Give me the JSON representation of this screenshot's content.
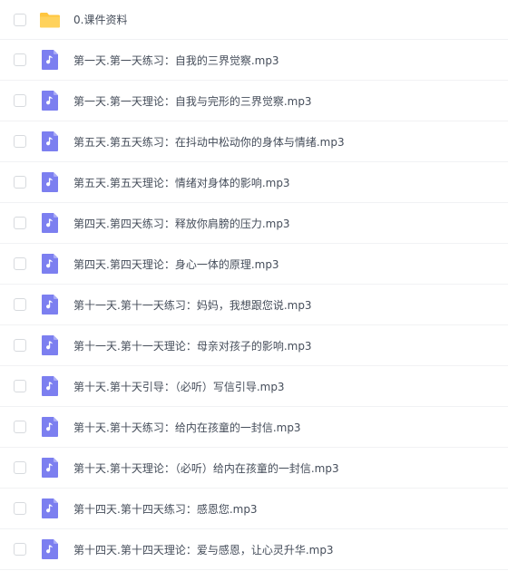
{
  "files": [
    {
      "name": "0.课件资料",
      "icon": "folder-icon",
      "type": "folder"
    },
    {
      "name": "第一天.第一天练习：自我的三界觉察.mp3",
      "icon": "audio-file-icon",
      "type": "audio"
    },
    {
      "name": "第一天.第一天理论：自我与完形的三界觉察.mp3",
      "icon": "audio-file-icon",
      "type": "audio"
    },
    {
      "name": "第五天.第五天练习：在抖动中松动你的身体与情绪.mp3",
      "icon": "audio-file-icon",
      "type": "audio"
    },
    {
      "name": "第五天.第五天理论：情绪对身体的影响.mp3",
      "icon": "audio-file-icon",
      "type": "audio"
    },
    {
      "name": "第四天.第四天练习：释放你肩膀的压力.mp3",
      "icon": "audio-file-icon",
      "type": "audio"
    },
    {
      "name": "第四天.第四天理论：身心一体的原理.mp3",
      "icon": "audio-file-icon",
      "type": "audio"
    },
    {
      "name": "第十一天.第十一天练习：妈妈，我想跟您说.mp3",
      "icon": "audio-file-icon",
      "type": "audio"
    },
    {
      "name": "第十一天.第十一天理论：母亲对孩子的影响.mp3",
      "icon": "audio-file-icon",
      "type": "audio"
    },
    {
      "name": "第十天.第十天引导：（必听）写信引导.mp3",
      "icon": "audio-file-icon",
      "type": "audio"
    },
    {
      "name": "第十天.第十天练习：给内在孩童的一封信.mp3",
      "icon": "audio-file-icon",
      "type": "audio"
    },
    {
      "name": "第十天.第十天理论：（必听）给内在孩童的一封信.mp3",
      "icon": "audio-file-icon",
      "type": "audio"
    },
    {
      "name": "第十四天.第十四天练习：感恩您.mp3",
      "icon": "audio-file-icon",
      "type": "audio"
    },
    {
      "name": "第十四天.第十四天理论：爱与感恩，让心灵升华.mp3",
      "icon": "audio-file-icon",
      "type": "audio"
    }
  ],
  "colors": {
    "folder": "#ffc63f",
    "audio": "#7c7ff0",
    "text": "#454d5a",
    "divider": "#f1f2f4"
  }
}
